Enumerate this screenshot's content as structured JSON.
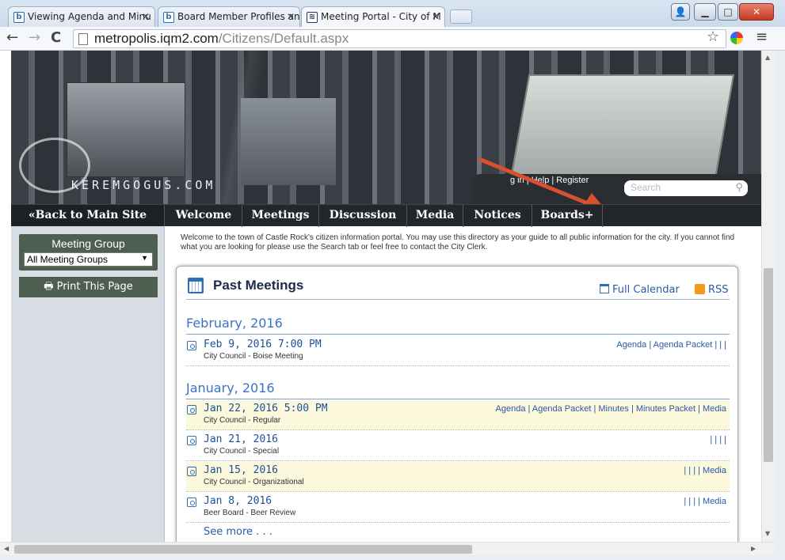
{
  "browser": {
    "tabs": [
      {
        "label": "Viewing Agenda and Minu",
        "icon": "b-favicon"
      },
      {
        "label": "Board Member Profiles an",
        "icon": "b-favicon"
      },
      {
        "label": "Meeting Portal - City of M",
        "icon": "portal-favicon",
        "active": true
      }
    ],
    "url_host": "metropolis.iqm2.com",
    "url_path": "/Citizens/Default.aspx",
    "window_buttons": [
      "minimize",
      "maximize",
      "close"
    ]
  },
  "site": {
    "logo": "KEREMGOGUS.COM",
    "login_links": "Log in | Help | Register",
    "login_visible": "g in | Help | Register",
    "search_placeholder": "Search",
    "back_link": "«Back to Main Site",
    "nav": [
      "Welcome",
      "Meetings",
      "Discussion",
      "Media",
      "Notices",
      "Boards+"
    ],
    "annotation_color": "#d9502f"
  },
  "sidebar": {
    "meeting_group_title": "Meeting Group",
    "meeting_group_selected": "All Meeting Groups",
    "print_button": "Print This Page"
  },
  "main": {
    "intro": "Welcome to the town of Castle Rock's citizen information portal. You may use this directory as your guide to all public information for the city. If you cannot find what you are looking for please use the Search tab or feel free to contact the City Clerk.",
    "title": "Past Meetings",
    "full_calendar": "Full Calendar",
    "rss": "RSS",
    "months": [
      {
        "label": "February, 2016",
        "meetings": [
          {
            "date": "Feb 9, 2016 7:00 PM",
            "name": "City Council - Boise Meeting",
            "links": "Agenda  |  Agenda Packet  |                 |                        |",
            "highlight": false
          }
        ]
      },
      {
        "label": "January, 2016",
        "meetings": [
          {
            "date": "Jan 22, 2016 5:00 PM",
            "name": "City Council - Regular",
            "links": "Agenda  |  Agenda Packet  |  Minutes  |  Minutes Packet  |  Media",
            "highlight": true
          },
          {
            "date": "Jan 21, 2016",
            "name": "City Council - Special",
            "links": "|                      |                 |                        |",
            "highlight": false
          },
          {
            "date": "Jan 15, 2016",
            "name": "City Council - Organizational",
            "links": "|                      |                 |                        |  Media",
            "highlight": true
          },
          {
            "date": "Jan 8, 2016",
            "name": "Beer Board - Beer Review",
            "links": "|                      |                 |                        |  Media",
            "highlight": false
          }
        ]
      }
    ],
    "see_more": "See more . . ."
  }
}
